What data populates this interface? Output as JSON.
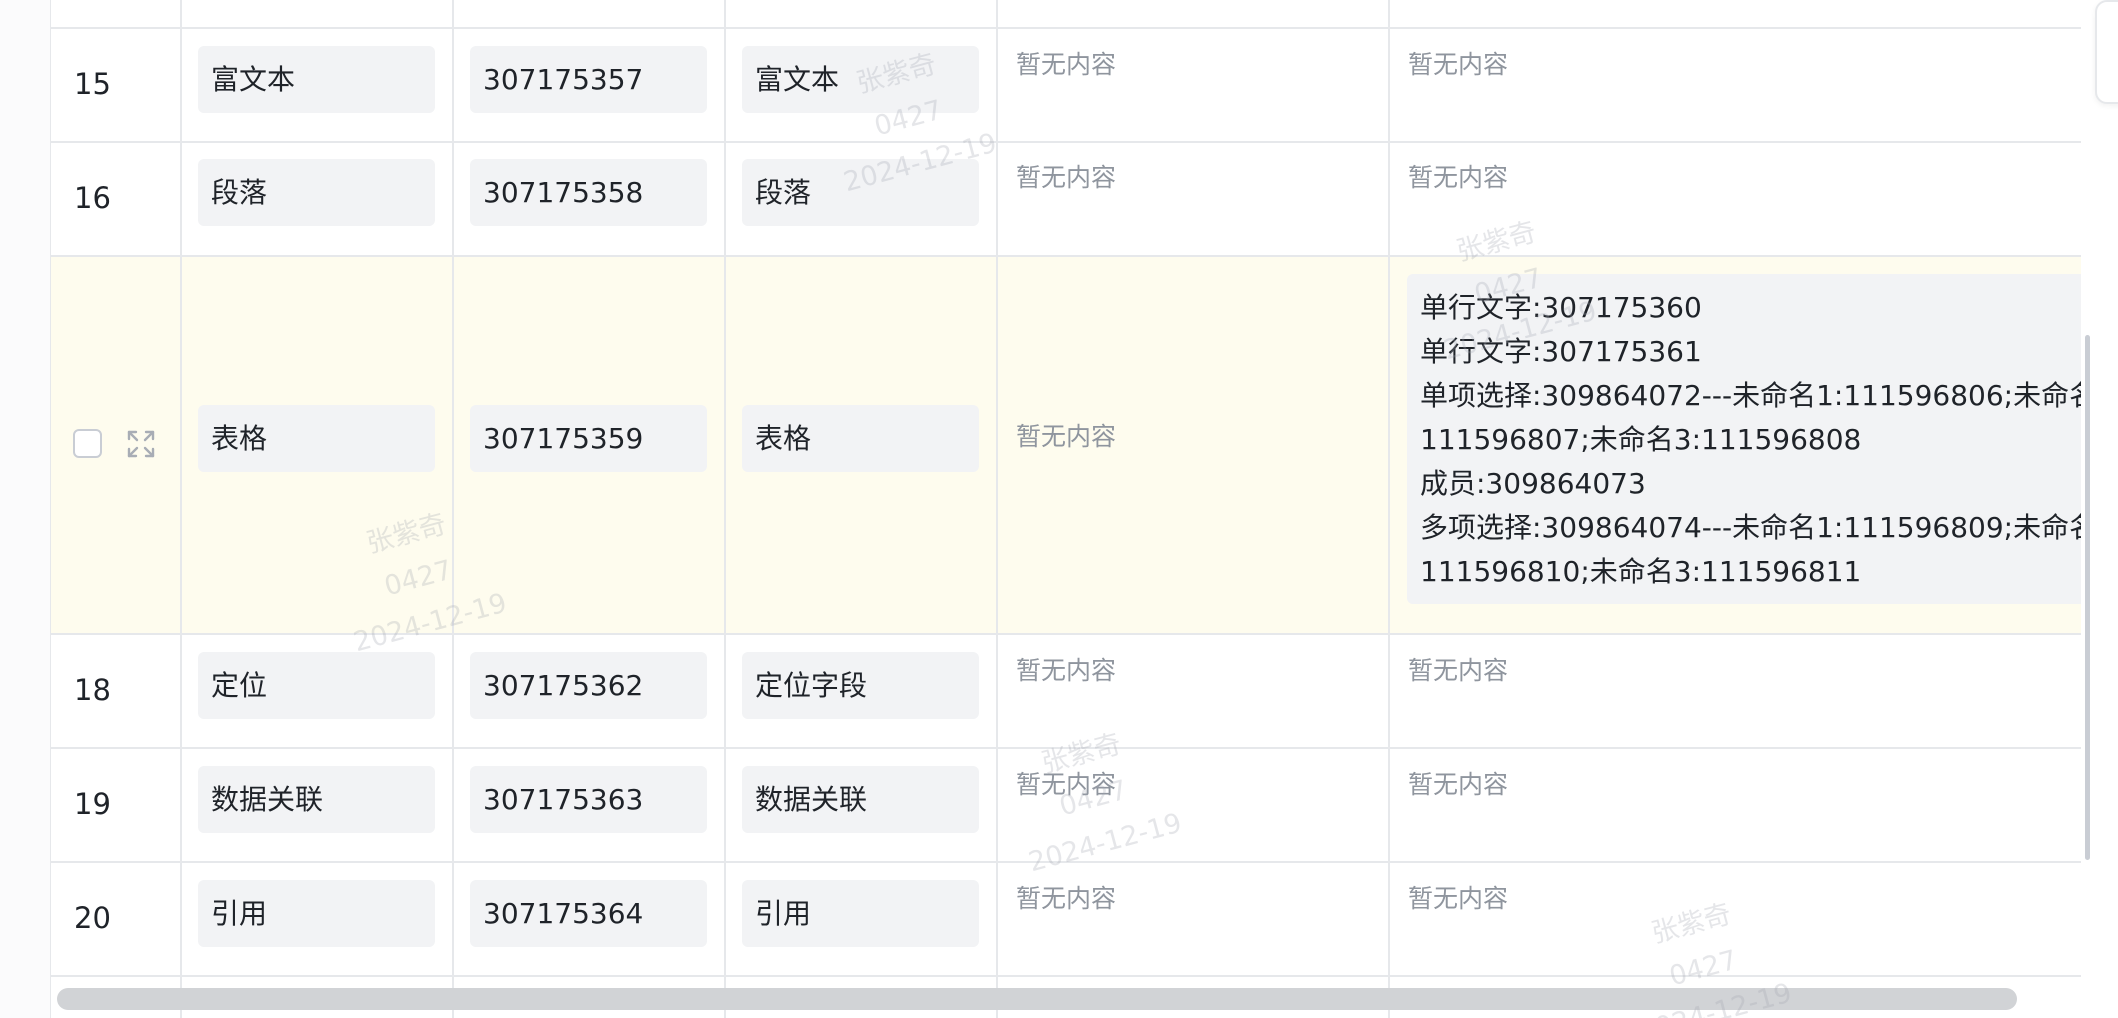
{
  "empty_text": "暂无内容",
  "rows": [
    {
      "num": "15",
      "field_type": "富文本",
      "field_id": "307175357",
      "field_name": "富文本",
      "col5": "暂无内容",
      "col6": "暂无内容"
    },
    {
      "num": "16",
      "field_type": "段落",
      "field_id": "307175358",
      "field_name": "段落",
      "col5": "暂无内容",
      "col6": "暂无内容"
    },
    {
      "num": "",
      "field_type": "表格",
      "field_id": "307175359",
      "field_name": "表格",
      "col5": "暂无内容",
      "detail_lines": [
        "单行文字:307175360",
        "单行文字:307175361",
        "单项选择:309864072---未命名1:111596806;未命名",
        "111596807;未命名3:111596808",
        "成员:309864073",
        "多项选择:309864074---未命名1:111596809;未命名",
        "111596810;未命名3:111596811"
      ]
    },
    {
      "num": "18",
      "field_type": "定位",
      "field_id": "307175362",
      "field_name": "定位字段",
      "col5": "暂无内容",
      "col6": "暂无内容"
    },
    {
      "num": "19",
      "field_type": "数据关联",
      "field_id": "307175363",
      "field_name": "数据关联",
      "col5": "暂无内容",
      "col6": "暂无内容"
    },
    {
      "num": "20",
      "field_type": "引用",
      "field_id": "307175364",
      "field_name": "引用",
      "col5": "暂无内容",
      "col6": "暂无内容"
    }
  ],
  "watermark": {
    "name": "张紫奇",
    "code": "0427",
    "date": "2024-12-19"
  },
  "colors": {
    "highlight_row": "#fefcee",
    "pill_bg": "#f2f3f5",
    "border": "#e6e8eb",
    "muted_text": "#8f959e"
  }
}
